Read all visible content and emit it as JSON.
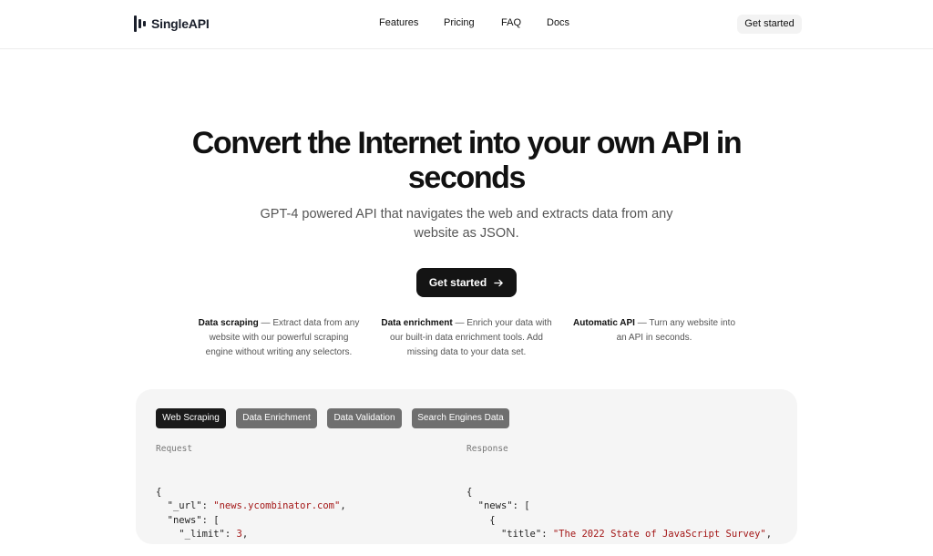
{
  "brand": {
    "name": "SingleAPI"
  },
  "nav": {
    "items": [
      "Features",
      "Pricing",
      "FAQ",
      "Docs"
    ],
    "cta": "Get started"
  },
  "hero": {
    "title": "Convert the Internet into your own API in seconds",
    "subtitle": "GPT-4 powered API that navigates the web and extracts data from any website as JSON.",
    "cta": "Get started"
  },
  "features": [
    {
      "title": "Data scraping",
      "text": "— Extract data from any website with our powerful scraping engine without writing any selectors."
    },
    {
      "title": "Data enrichment",
      "text": "— Enrich your data with our built-in data enrichment tools. Add missing data to your data set."
    },
    {
      "title": "Automatic API",
      "text": "— Turn any website into an API in seconds."
    }
  ],
  "demo": {
    "tabs": [
      "Web Scraping",
      "Data Enrichment",
      "Data Validation",
      "Search Engines Data"
    ],
    "active_tab": "Web Scraping",
    "request_label": "Request",
    "response_label": "Response",
    "request_lines": [
      "{",
      "  \"_url\": \"news.ycombinator.com\",",
      "  \"news\": [",
      "    \"_limit\": 3,"
    ],
    "response_lines": [
      "{",
      "  \"news\": [",
      "    {",
      "      \"title\": \"The 2022 State of JavaScript Survey\","
    ]
  }
}
